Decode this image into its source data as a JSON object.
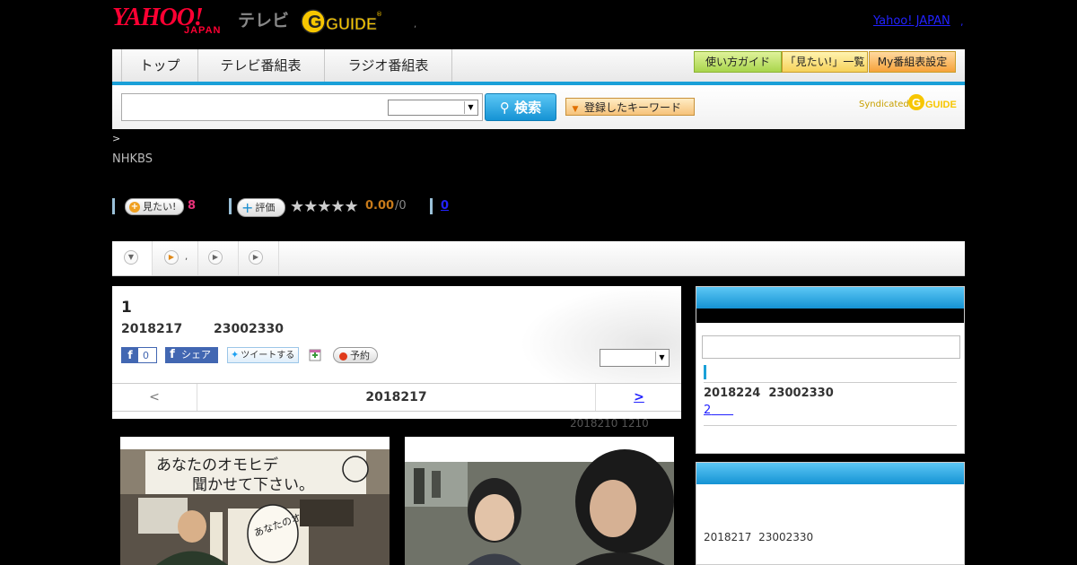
{
  "header": {
    "yahoo_logo": "YAHOO!",
    "japan_logo": "JAPAN",
    "tv_label": "テレビ",
    "gguide_logo": "G-GUIDE",
    "dot": ",",
    "yahoo_japan_link": "Yahoo! JAPAN",
    "link_dot": ","
  },
  "nav": {
    "tabs": [
      {
        "label": "トップ"
      },
      {
        "label": "テレビ番組表"
      },
      {
        "label": "ラジオ番組表"
      }
    ],
    "buttons": [
      {
        "label": "使い方ガイド"
      },
      {
        "label": "「見たい!」一覧"
      },
      {
        "label": "My番組表設定"
      }
    ]
  },
  "search": {
    "input_value": "",
    "select_value": "",
    "button_label": "検索",
    "keyword_button": "登録したキーワード",
    "syndicated": "Syndicated"
  },
  "program_meta": {
    "breadcrumb": ">",
    "channel": "NHKBS",
    "mitai_label": "見たい!",
    "mitai_count": "8",
    "hyoka_label": "評価",
    "stars": "★★★★★",
    "score": "0.00",
    "score_count": "/0",
    "review_count": "0"
  },
  "tabs_row": {
    "tab2_suffix": ","
  },
  "program": {
    "title": "1",
    "date": "2018217",
    "time": "23002330",
    "fb_like_count": "0",
    "fb_share": "シェア",
    "tweet": "ツイートする",
    "reserve": "予約",
    "select_value": ""
  },
  "day_nav": {
    "prev": "<",
    "current": "2018217",
    "next": ">"
  },
  "update_note": "2018210  1210",
  "images": [
    {
      "banner_text": "あなたのオモヒデ 聞かせて下さい。",
      "sign_text": "あなたのオ"
    },
    {
      "description_icon": "photo"
    }
  ],
  "sidebar": {
    "next_date": "2018224",
    "next_time": "23002330",
    "next_link": "2",
    "bottom_date": "2018217",
    "bottom_time": "23002330"
  }
}
